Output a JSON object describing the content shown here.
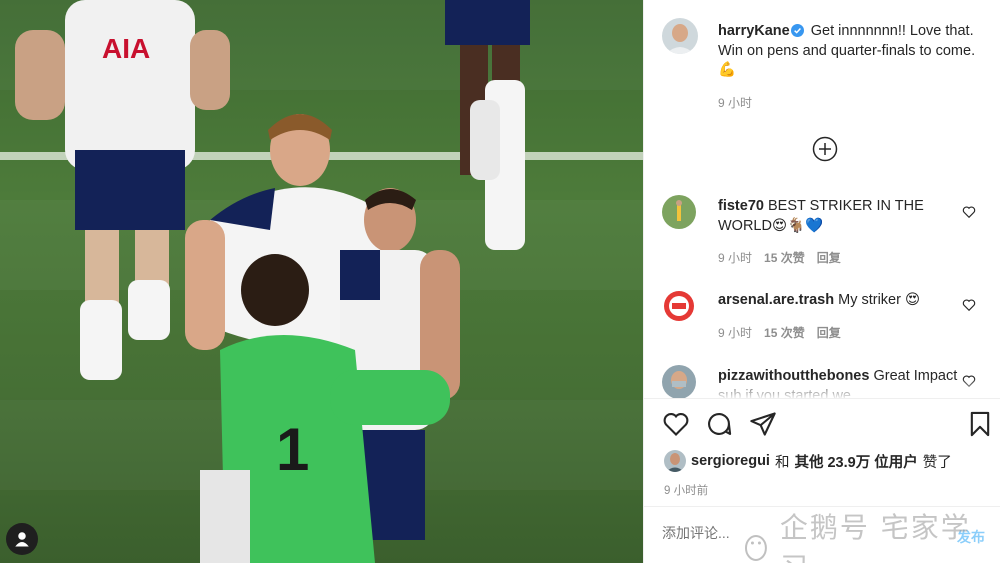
{
  "post": {
    "author": "harryKane",
    "caption_text": "Get innnnnnn!! Love that. Win on pens and quarter-finals to come. 💪",
    "time": "9 小时",
    "verified_color": "#3897f0"
  },
  "comments": [
    {
      "user": "fiste70",
      "text": "BEST STRIKER IN THE WORLD😍🐐💙",
      "time": "9 小时",
      "likes": "15 次赞",
      "reply": "回复"
    },
    {
      "user": "arsenal.are.trash",
      "text": "My striker 😍",
      "time": "9 小时",
      "likes": "15 次赞",
      "reply": "回复"
    },
    {
      "user": "pizzawithoutthebones",
      "text": "Great Impact sub if you started we",
      "time": "",
      "likes": "",
      "reply": ""
    }
  ],
  "likes": {
    "user": "sergioregui",
    "and": "和",
    "others": "其他 23.9万 位用户",
    "suffix": "赞了"
  },
  "post_time": "9 小时前",
  "comment_input": {
    "placeholder": "添加评论..."
  },
  "post_button": "发布",
  "watermark": "企鹅号 宅家学习",
  "colors": {
    "accent": "#0095f6",
    "muted": "#8e8e8e",
    "heart_red": "#ed4956"
  }
}
